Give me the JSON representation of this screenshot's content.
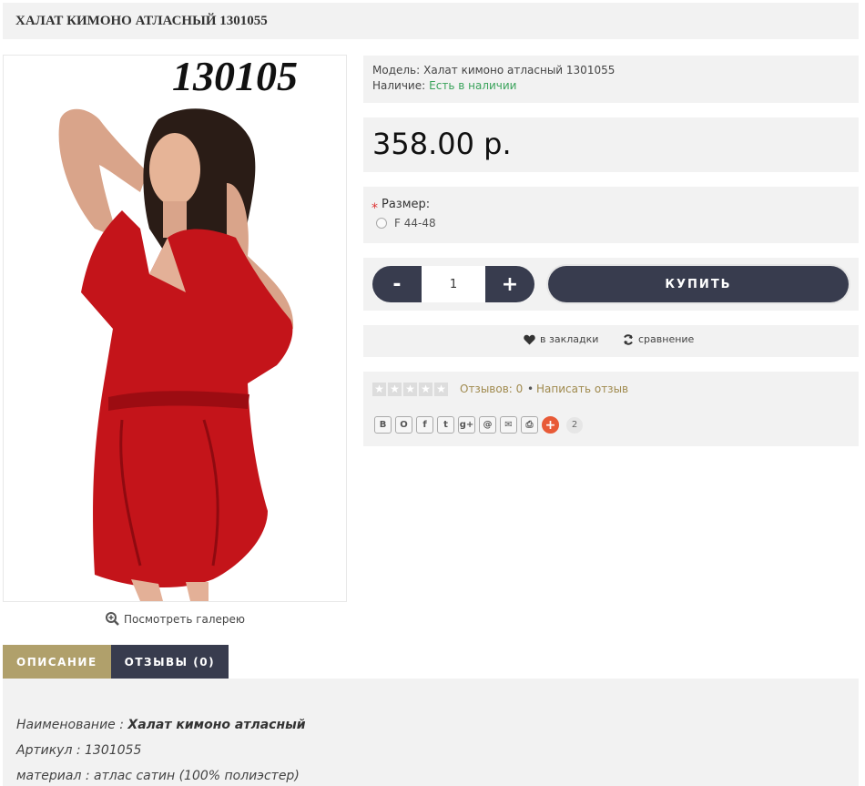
{
  "product": {
    "title": "ХАЛАТ КИМОНО АТЛАСНЫЙ 1301055",
    "image_caption": "130105",
    "gallery_link": "Посмотреть галерею",
    "model_label": "Модель:",
    "model_value": "Халат кимоно атласный 1301055",
    "stock_label": "Наличие:",
    "stock_value": "Есть в наличии",
    "price": "358.00 р.",
    "size_required": "*",
    "size_label": "Размер:",
    "size_option": "F 44-48",
    "qty_minus": "-",
    "qty_value": "1",
    "qty_plus": "+",
    "buy_label": "КУПИТЬ",
    "bookmark_label": "в закладки",
    "compare_label": "сравнение",
    "reviews_link": "Отзывов: 0",
    "reviews_separator": "•",
    "write_review": "Написать отзыв",
    "share_count": "2",
    "share_buttons": [
      "В",
      "О",
      "f",
      "t",
      "g+",
      "@",
      "✉",
      "⎙",
      "+"
    ]
  },
  "tabs": {
    "description": "ОПИСАНИЕ",
    "reviews": "ОТЗЫВЫ (0)"
  },
  "description": {
    "name_label": "Наименование : ",
    "name_value": "Халат кимоно атласный",
    "sku_line": "Артикул : 1301055",
    "material_line": "материал : атлас сатин (100% полиэстер)"
  },
  "colors": {
    "dark": "#383c4e",
    "gold": "#b0a06b",
    "stock_green": "#3aa35b",
    "dress_red": "#c4141a"
  }
}
